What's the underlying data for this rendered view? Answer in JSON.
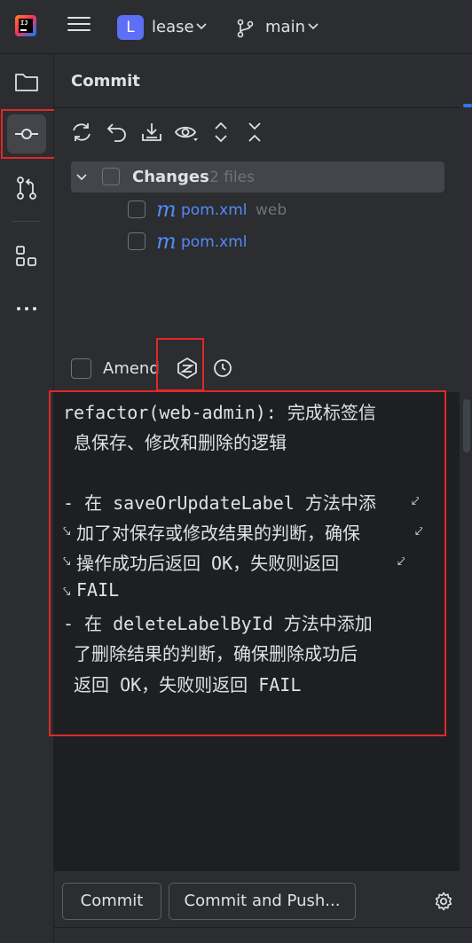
{
  "topbar": {
    "project_initial": "L",
    "project_name": "lease",
    "branch_name": "main"
  },
  "toolbar": {
    "items": [
      "folder-icon",
      "commit-icon",
      "pull-requests-icon",
      "structure-icon",
      "more-icon"
    ]
  },
  "panel": {
    "title": "Commit",
    "actions": [
      "refresh-icon",
      "rollback-icon",
      "shelve-icon",
      "show-diff-icon",
      "expand-all-icon",
      "collapse-all-icon"
    ]
  },
  "changes": {
    "label": "Changes",
    "count": "2 files",
    "files": [
      {
        "icon": "m",
        "name": "pom.xml",
        "dir": "web"
      },
      {
        "icon": "m",
        "name": "pom.xml",
        "dir": ""
      }
    ]
  },
  "amend": {
    "label": "Amend"
  },
  "message": {
    "lines": [
      "refactor(web-admin): 完成标签信",
      " 息保存、修改和删除的逻辑",
      "",
      "- 在 saveOrUpdateLabel 方法中添",
      "加了对保存或修改结果的判断，确保",
      "操作成功后返回 OK，失败则返回 ",
      "FAIL",
      "- 在 deleteLabelById 方法中添加",
      " 了删除结果的判断，确保删除成功后",
      " 返回 OK，失败则返回 FAIL"
    ]
  },
  "buttons": {
    "commit": "Commit",
    "commit_push": "Commit and Push..."
  },
  "colors": {
    "accent": "#3574f0",
    "highlight": "#e02828",
    "file_link": "#548af7"
  }
}
